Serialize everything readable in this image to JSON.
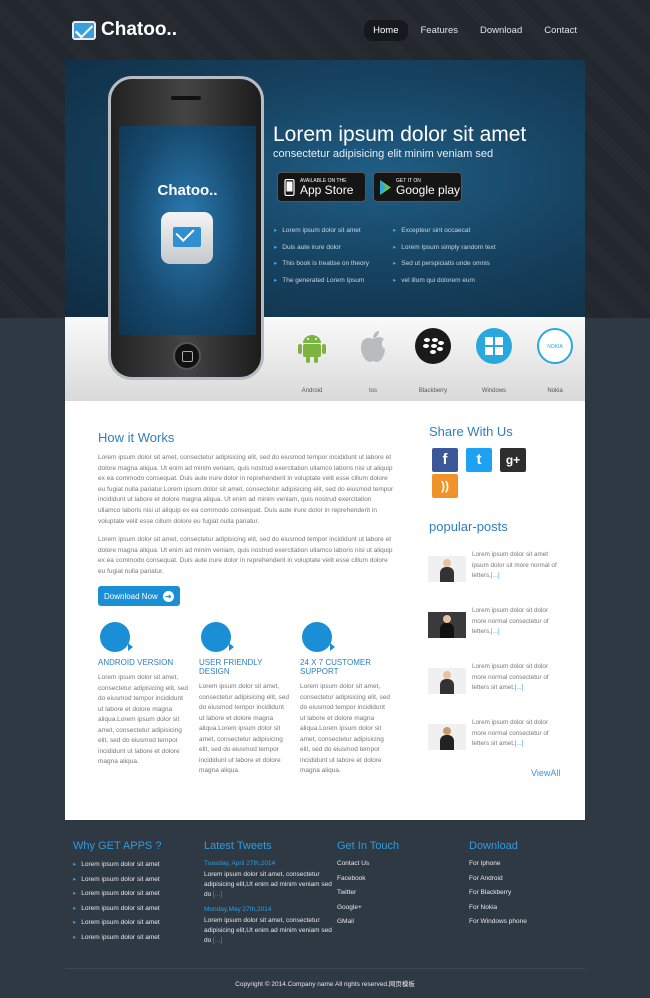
{
  "header": {
    "logo": "Chatoo..",
    "nav": [
      "Home",
      "Features",
      "Download",
      "Contact"
    ]
  },
  "hero": {
    "title": "Lorem ipsum dolor sit amet",
    "subtitle": "consectetur adipisicing elit minim veniam sed",
    "phone_title": "Chatoo..",
    "appstore_small": "AVAILABLE ON THE",
    "appstore_big": "App Store",
    "googleplay_small": "GET IT ON",
    "googleplay_big": "Google play",
    "features_left": [
      "Lorem ipsum dolor sit amet",
      "Duis aute irure dolor",
      "This book is treatise on theory",
      "The generated Lorem Ipsum"
    ],
    "features_right": [
      "Excepteur sint occaecat",
      "Lorem Ipsum simply random text",
      "Sed ut perspiciatis unde omnis",
      "vel illum qui dolorem eum"
    ]
  },
  "platforms": [
    {
      "label": "Android",
      "icon": "android-icon",
      "color": "#7cb342"
    },
    {
      "label": "Ios",
      "icon": "apple-icon",
      "color": "#b9bcbf"
    },
    {
      "label": "Blackberry",
      "icon": "blackberry-icon",
      "color": "#1a1a1a"
    },
    {
      "label": "Windows",
      "icon": "windows-icon",
      "color": "#29a8e0"
    },
    {
      "label": "Nokia",
      "icon": "nokia-icon",
      "color": "#29a8e0",
      "badge": "NOKIA"
    }
  ],
  "how": {
    "heading": "How it Works",
    "para1": "Lorem ipsum dolor sit amet, consectetur adipisicing elit, sed do eiusmod tempor incididunt ut labore et dolore magna aliqua. Ut enim ad minim veniam, quis nostrud exercitation ullamco laboris nisi ut aliquip ex ea commodo consequat. Duis aute irure dolor in reprehenderit in voluptate velit esse cillum dolore eu fugiat nulla pariatur.Lorem ipsum dolor sit amet, consectetur adipisicing elit, sed do eiusmod tempor incididunt ut labore et dolore magna aliqua. Ut enim ad minim veniam, quis nostrud exercitation ullamco laboris nisi ut aliquip ex ea commodo consequat. Duis aute irure dolor in reprehenderit in voluptate velit esse cillum dolore eu fugiat nulla pariatur.",
    "para2": "Lorem ipsum dolor sit amet, consectetur adipisicing elit, sed do eiusmod tempor incididunt ut labore et dolore magna aliqua. Ut enim ad minim veniam, quis nostrud exercitation ullamco laboris nisi ut aliquip ex ea commodo consequat. Duis aute irure dolor in reprehenderit in voluptate velit esse cillum dolore eu fugiat nulla pariatur.",
    "download_button": "Download Now"
  },
  "features": [
    {
      "title": "ANDROID VERSION",
      "text": "Lorem ipsum dolor sit amet, consectetur adipisicing elit, sed do eiusmod tempor incididunt ut labore et dolore magna aliqua.Lorem ipsum dolor sit amet, consectetur adipisicing elit, sed do eiusmod tempor incididunt ut labore et dolore magna aliqua."
    },
    {
      "title": "USER FRIENDLY DESIGN",
      "text": "Lorem ipsum dolor sit amet, consectetur adipisicing elit, sed do eiusmod tempor incididunt ut labore et dolore magna aliqua.Lorem ipsum dolor sit amet, consectetur adipisicing elit, sed do eiusmod tempor incididunt ut labore et dolore magna aliqua."
    },
    {
      "title": "24 X 7 CUSTOMER SUPPORT",
      "text": "Lorem ipsum dolor sit amet, consectetur adipisicing elit, sed do eiusmod tempor incididunt ut labore et dolore magna aliqua.Lorem ipsum dolor sit amet, consectetur adipisicing elit, sed do eiusmod tempor incididunt ut labore et dolore magna aliqua."
    }
  ],
  "sidebar": {
    "share_heading": "Share With Us",
    "popular_heading": "popular-posts",
    "posts": [
      {
        "text": "Lorem ipsum dolor sit amet ipsum dolor sit more normal of letters,",
        "more": "[...]"
      },
      {
        "text": "Lorem ipsum dolor sit dolor more normal consectetur of letters,",
        "more": "[...]"
      },
      {
        "text": "Lorem ipsum dolor sit dolor more normal consectetur of letters sit amet,",
        "more": "[...]"
      },
      {
        "text": "Lorem ipsum dolor sit dolor more normal consectetur of letters sit amet,",
        "more": "[...]"
      }
    ],
    "view_all": "ViewAll"
  },
  "footer": {
    "col1": {
      "heading": "Why GET APPS ?",
      "items": [
        "Lorem ipsum dolor sit amet",
        "Lorem ipsum dolor sit amet",
        "Lorem ipsum dolor sit amet",
        "Lorem ipsum dolor sit amet",
        "Lorem ipsum dolor sit amet",
        "Lorem ipsum dolor sit amet"
      ]
    },
    "col2": {
      "heading": "Latest Tweets",
      "tweets": [
        {
          "date": "Tuesday, April 27th,2014",
          "text": "Lorem ipsum dolor sit amet, consectetur adipisicing elit,Ut enim ad minim veniam sed do",
          "more": "[...]"
        },
        {
          "date": "Monday,May 27th,2014",
          "text": "Lorem ipsum dolor sit amet, consectetur adipisicing elit,Ut enim ad minim veniam sed do",
          "more": "[...]"
        }
      ]
    },
    "col3": {
      "heading": "Get In Touch",
      "items": [
        "Contact Us",
        "Facebook",
        "Twitter",
        "Google+",
        "GMail"
      ]
    },
    "col4": {
      "heading": "Download",
      "items": [
        "For Iphone",
        "For Android",
        "For Blackberry",
        "For Nokia",
        "For Windows phone"
      ]
    },
    "copyright": "Copyright © 2014.Company name All rights reserved.网页模板"
  },
  "colors": {
    "accent": "#1b8fd6",
    "dark_bg": "#2f3944"
  }
}
